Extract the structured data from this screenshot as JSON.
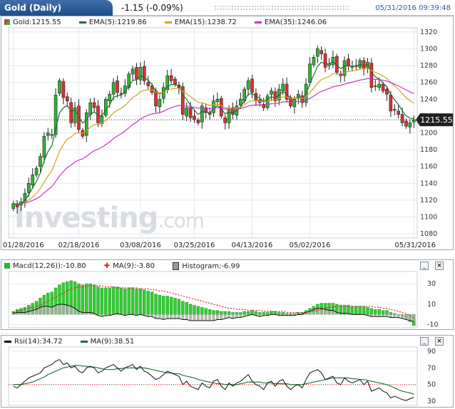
{
  "header": {
    "title": "Gold (Daily)",
    "change": "-1.15 (-0.09%)",
    "timestamp": "05/31/2016 09:39:48"
  },
  "main_panel": {
    "legend": [
      {
        "label": "Gold:1215.55",
        "color": "#2eb52e"
      },
      {
        "label": "EMA(5):1219.86",
        "color": "#1f6b32"
      },
      {
        "label": "EMA(15):1238.72",
        "color": "#d6a21e"
      },
      {
        "label": "EMA(35):1246.06",
        "color": "#cc33cc"
      }
    ],
    "last_price_label": "1215.55",
    "watermark": "Investing.com"
  },
  "macd_panel": {
    "legend": [
      {
        "label": "Macd(12,26)):-10.80",
        "color": "#2eb52e"
      },
      {
        "label": "MA(9):-3.80",
        "color": "#e02020"
      },
      {
        "label": "Histogram:-6.99",
        "color": "#9a9a9a"
      }
    ],
    "controls": [
      "_",
      "×"
    ]
  },
  "rsi_panel": {
    "legend": [
      {
        "label": "Rsi(14):34.72",
        "color": "#111111"
      },
      {
        "label": "MA(9):38.51",
        "color": "#1f6b32"
      }
    ],
    "controls": [
      "_",
      "×"
    ]
  },
  "chart_data": [
    {
      "type": "candlestick",
      "x_tick_labels": [
        "01/28/2016",
        "02/18/2016",
        "03/08/2016",
        "03/25/2016",
        "04/13/2016",
        "05/02/2016",
        "05/31/2016"
      ],
      "y_ticks": [
        1080,
        1100,
        1120,
        1140,
        1160,
        1180,
        1200,
        1220,
        1240,
        1260,
        1280,
        1300,
        1320
      ],
      "ylim": [
        1075,
        1325
      ],
      "grid": true,
      "last_price": 1215.55,
      "closes": [
        1116,
        1112,
        1118,
        1128,
        1140,
        1150,
        1158,
        1172,
        1196,
        1200,
        1198,
        1245,
        1262,
        1242,
        1238,
        1212,
        1230,
        1204,
        1196,
        1224,
        1236,
        1230,
        1212,
        1220,
        1240,
        1246,
        1260,
        1248,
        1246,
        1256,
        1270,
        1276,
        1264,
        1278,
        1262,
        1256,
        1248,
        1232,
        1240,
        1254,
        1268,
        1262,
        1258,
        1254,
        1222,
        1230,
        1218,
        1216,
        1212,
        1232,
        1224,
        1222,
        1238,
        1240,
        1220,
        1212,
        1228,
        1222,
        1232,
        1240,
        1252,
        1262,
        1248,
        1238,
        1236,
        1230,
        1244,
        1250,
        1238,
        1252,
        1258,
        1240,
        1232,
        1240,
        1246,
        1236,
        1258,
        1282,
        1290,
        1300,
        1294,
        1278,
        1282,
        1290,
        1272,
        1268,
        1286,
        1280,
        1278,
        1280,
        1286,
        1276,
        1284,
        1254,
        1256,
        1258,
        1250,
        1246,
        1226,
        1228,
        1222,
        1212,
        1208,
        1212,
        1215.55
      ],
      "series": [
        {
          "name": "EMA(5)",
          "color": "#1f6b32",
          "last": 1219.86
        },
        {
          "name": "EMA(15)",
          "color": "#d6a21e",
          "last": 1238.72
        },
        {
          "name": "EMA(35)",
          "color": "#cc33cc",
          "last": 1246.06
        }
      ]
    },
    {
      "type": "bar",
      "name": "MACD",
      "y_ticks": [
        30,
        10,
        -10
      ],
      "ylim": [
        -13,
        42
      ],
      "macd": [
        3,
        5,
        6,
        7,
        9,
        11,
        13,
        16,
        19,
        21,
        22,
        26,
        29,
        31,
        32,
        33,
        32,
        30,
        29,
        30,
        30,
        29,
        27,
        26,
        26,
        26,
        27,
        27,
        26,
        25,
        26,
        26,
        25,
        25,
        24,
        23,
        22,
        20,
        19,
        18,
        18,
        17,
        16,
        15,
        13,
        12,
        10,
        9,
        8,
        7,
        6,
        5,
        4,
        4,
        3,
        3,
        3,
        2,
        2,
        2,
        3,
        3,
        4,
        3,
        2,
        2,
        2,
        3,
        3,
        2,
        2,
        1,
        1,
        1,
        2,
        2,
        4,
        6,
        8,
        10,
        11,
        11,
        11,
        11,
        10,
        9,
        9,
        9,
        8,
        8,
        8,
        8,
        7,
        6,
        5,
        5,
        4,
        4,
        2,
        1,
        0,
        -2,
        -4,
        -7,
        -10.8
      ],
      "signal_ma9": [
        2,
        3,
        4,
        5,
        6,
        7,
        8,
        9,
        11,
        13,
        15,
        17,
        19,
        21,
        23,
        25,
        26,
        27,
        27,
        28,
        28,
        28,
        28,
        28,
        27,
        27,
        27,
        26,
        26,
        26,
        26,
        26,
        26,
        25,
        25,
        25,
        24,
        24,
        23,
        23,
        22,
        21,
        20,
        19,
        18,
        17,
        16,
        15,
        14,
        13,
        12,
        11,
        10,
        9,
        8,
        7,
        6,
        6,
        5,
        5,
        5,
        4,
        4,
        4,
        4,
        3,
        3,
        3,
        3,
        3,
        3,
        2,
        2,
        2,
        2,
        2,
        2,
        3,
        3,
        4,
        5,
        6,
        7,
        7,
        8,
        8,
        8,
        8,
        8,
        8,
        8,
        8,
        8,
        8,
        7,
        7,
        6,
        6,
        5,
        4,
        3,
        2,
        1,
        -1,
        -3.8
      ],
      "histogram": [
        1,
        2,
        2,
        2,
        3,
        4,
        5,
        7,
        8,
        8,
        7,
        9,
        10,
        10,
        9,
        8,
        6,
        3,
        2,
        2,
        2,
        1,
        -1,
        -2,
        -1,
        -1,
        0,
        1,
        0,
        -1,
        0,
        0,
        -1,
        0,
        -1,
        -2,
        -2,
        -4,
        -4,
        -5,
        -4,
        -4,
        -4,
        -4,
        -5,
        -5,
        -6,
        -6,
        -6,
        -6,
        -6,
        -6,
        -6,
        -5,
        -5,
        -4,
        -3,
        -4,
        -3,
        -3,
        -2,
        -1,
        0,
        -1,
        -2,
        -1,
        -1,
        0,
        0,
        -1,
        -1,
        -1,
        -1,
        -1,
        0,
        0,
        2,
        3,
        5,
        6,
        6,
        5,
        4,
        4,
        2,
        1,
        1,
        1,
        0,
        0,
        0,
        0,
        -1,
        -2,
        -2,
        -2,
        -2,
        -2,
        -3,
        -3,
        -3,
        -4,
        -5,
        -6,
        -6.99
      ]
    },
    {
      "type": "line",
      "name": "RSI",
      "y_ticks": [
        90,
        70,
        50,
        30
      ],
      "ylim": [
        25,
        95
      ],
      "reference_line": 50,
      "rsi": [
        48,
        46,
        50,
        54,
        58,
        60,
        62,
        64,
        70,
        72,
        74,
        78,
        80,
        74,
        76,
        70,
        72,
        66,
        64,
        70,
        72,
        70,
        64,
        66,
        70,
        72,
        74,
        70,
        66,
        70,
        72,
        74,
        68,
        72,
        66,
        64,
        60,
        56,
        58,
        62,
        66,
        64,
        62,
        60,
        50,
        54,
        48,
        46,
        44,
        52,
        48,
        46,
        54,
        56,
        48,
        44,
        52,
        48,
        52,
        54,
        58,
        62,
        54,
        50,
        48,
        44,
        52,
        54,
        48,
        54,
        56,
        48,
        44,
        48,
        50,
        46,
        56,
        64,
        66,
        68,
        64,
        56,
        58,
        60,
        52,
        50,
        58,
        54,
        52,
        54,
        56,
        50,
        54,
        42,
        44,
        46,
        42,
        40,
        34,
        36,
        34,
        32,
        31,
        33,
        34.72
      ],
      "rsi_ma9": [
        50,
        50,
        50,
        51,
        52,
        53,
        55,
        57,
        59,
        62,
        64,
        66,
        68,
        70,
        71,
        72,
        73,
        73,
        72,
        72,
        71,
        71,
        70,
        69,
        68,
        68,
        68,
        69,
        69,
        70,
        70,
        70,
        70,
        70,
        70,
        69,
        68,
        67,
        66,
        65,
        64,
        64,
        63,
        63,
        61,
        60,
        59,
        58,
        56,
        55,
        54,
        53,
        52,
        51,
        51,
        50,
        50,
        50,
        50,
        51,
        52,
        53,
        53,
        53,
        53,
        52,
        52,
        52,
        51,
        51,
        51,
        51,
        50,
        50,
        50,
        50,
        51,
        52,
        53,
        54,
        55,
        56,
        57,
        58,
        58,
        58,
        58,
        58,
        57,
        57,
        56,
        56,
        55,
        54,
        53,
        52,
        51,
        50,
        48,
        46,
        44,
        42,
        41,
        40,
        38.51
      ]
    }
  ]
}
